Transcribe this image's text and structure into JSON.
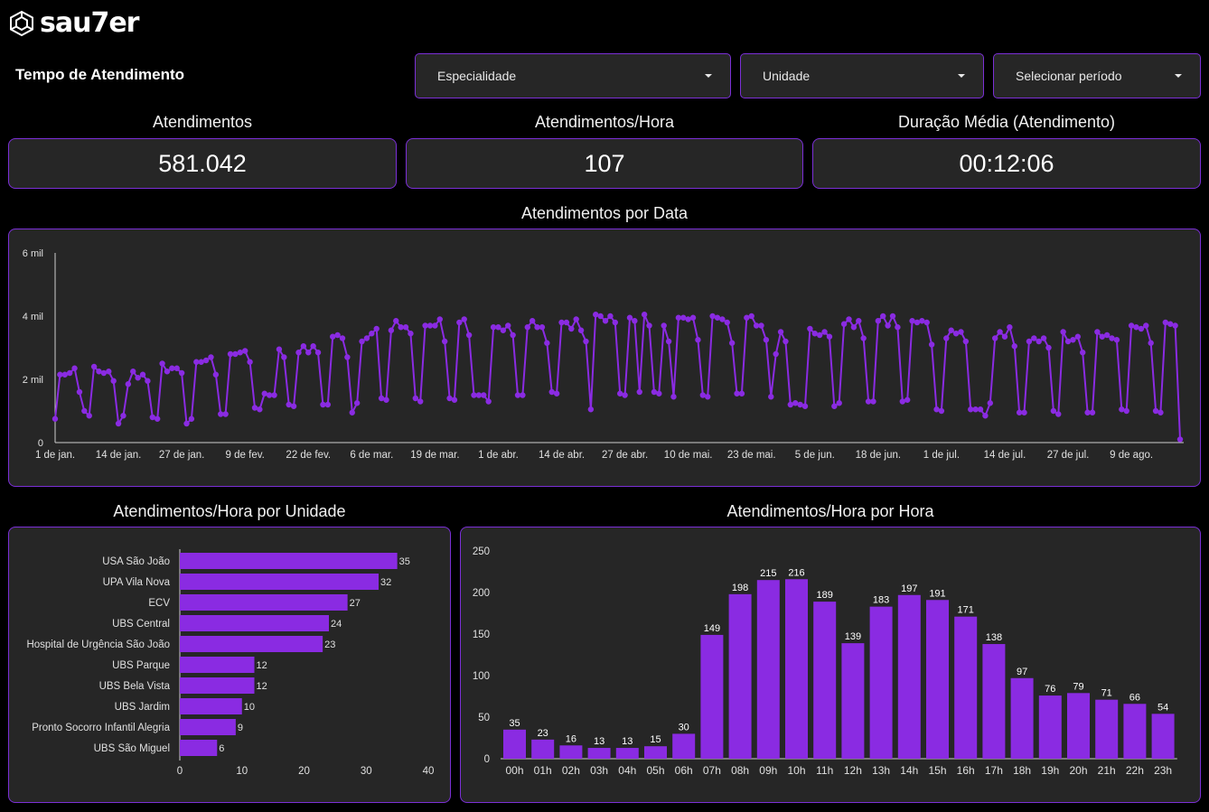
{
  "brand": {
    "name": "sau7er",
    "logo_icon": "hexagon-logo-icon"
  },
  "page": {
    "title": "Tempo de Atendimento"
  },
  "filters": [
    {
      "label": "Especialidade",
      "icon": "chevron-down-icon"
    },
    {
      "label": "Unidade",
      "icon": "chevron-down-icon"
    },
    {
      "label": "Selecionar período",
      "icon": "chevron-down-icon"
    }
  ],
  "kpis": [
    {
      "label": "Atendimentos",
      "value": "581.042"
    },
    {
      "label": "Atendimentos/Hora",
      "value": "107"
    },
    {
      "label": "Duração Média (Atendimento)",
      "value": "00:12:06"
    }
  ],
  "colors": {
    "accent": "#8a2be2",
    "panel_bg": "#262626",
    "border": "#7b2fd6",
    "background": "#000000"
  },
  "chart_data": [
    {
      "type": "line",
      "title": "Atendimentos por Data",
      "ylim": [
        0,
        6000
      ],
      "yticks": [
        0,
        2000,
        4000,
        6000
      ],
      "ytick_labels": [
        "0",
        "2 mil",
        "4 mil",
        "6 mil"
      ],
      "xtick_labels": [
        "1 de jan.",
        "14 de jan.",
        "27 de jan.",
        "9 de fev.",
        "22 de fev.",
        "6 de mar.",
        "19 de mar.",
        "1 de abr.",
        "14 de abr.",
        "27 de abr.",
        "10 de mai.",
        "23 de mai.",
        "5 de jun.",
        "18 de jun.",
        "1 de jul.",
        "14 de jul.",
        "27 de jul.",
        "9 de ago."
      ],
      "xtick_index": [
        0,
        13,
        26,
        39,
        52,
        65,
        78,
        91,
        104,
        117,
        130,
        143,
        156,
        169,
        182,
        195,
        208,
        221
      ],
      "series": [
        {
          "values": [
            750,
            2150,
            2150,
            2200,
            2350,
            1600,
            1000,
            850,
            2400,
            2250,
            2200,
            2250,
            1950,
            600,
            850,
            1850,
            2250,
            2050,
            2150,
            1950,
            800,
            750,
            2500,
            2250,
            2350,
            2350,
            2200,
            600,
            750,
            2550,
            2550,
            2600,
            2700,
            2150,
            900,
            900,
            2800,
            2800,
            2850,
            2900,
            2550,
            1100,
            1050,
            1550,
            1500,
            1500,
            2950,
            2700,
            1200,
            1150,
            2850,
            3050,
            2850,
            3050,
            2850,
            1200,
            1200,
            3350,
            3400,
            3300,
            2700,
            950,
            1250,
            3200,
            3300,
            3450,
            3600,
            1400,
            1350,
            3550,
            3850,
            3650,
            3650,
            3450,
            1400,
            1300,
            3700,
            3700,
            3700,
            3900,
            3200,
            1400,
            1350,
            3800,
            3900,
            3400,
            1500,
            1500,
            1500,
            1300,
            3650,
            3650,
            3550,
            3700,
            3400,
            1500,
            1500,
            3650,
            3850,
            3650,
            3650,
            3150,
            1600,
            1550,
            3800,
            3800,
            3600,
            3900,
            3550,
            3200,
            1050,
            4050,
            4000,
            3850,
            4000,
            3800,
            1550,
            1500,
            3950,
            3850,
            1600,
            4050,
            3700,
            1600,
            1550,
            3700,
            3200,
            1450,
            3950,
            3950,
            3900,
            3950,
            3250,
            1500,
            1450,
            4000,
            3950,
            3900,
            3800,
            3150,
            1550,
            1550,
            3950,
            4000,
            3700,
            3700,
            3250,
            1450,
            2800,
            3500,
            3200,
            1200,
            1250,
            1200,
            1150,
            3600,
            3450,
            3400,
            3500,
            3350,
            1150,
            1250,
            3750,
            3900,
            3650,
            3850,
            3300,
            1300,
            1300,
            3850,
            4000,
            3700,
            4000,
            3650,
            1300,
            1350,
            3850,
            3800,
            3850,
            3800,
            3100,
            1050,
            1000,
            3300,
            3550,
            3450,
            3500,
            3200,
            1050,
            1050,
            1050,
            850,
            1250,
            3300,
            3500,
            3350,
            3650,
            3050,
            950,
            950,
            3200,
            3300,
            3200,
            3300,
            3000,
            1000,
            900,
            3500,
            3200,
            3250,
            3350,
            2850,
            950,
            950,
            3500,
            3350,
            3400,
            3300,
            3250,
            1050,
            1000,
            3700,
            3650,
            3600,
            3700,
            3150,
            1000,
            950,
            3800,
            3750,
            3700,
            100
          ]
        }
      ]
    },
    {
      "type": "bar",
      "title": "Atendimentos/Hora por Unidade",
      "orientation": "horizontal",
      "categories": [
        "USA São João",
        "UPA Vila Nova",
        "ECV",
        "UBS Central",
        "Hospital de Urgência São João",
        "UBS Parque",
        "UBS Bela Vista",
        "UBS Jardim",
        "Pronto Socorro Infantil Alegria",
        "UBS São Miguel"
      ],
      "values": [
        35,
        32,
        27,
        24,
        23,
        12,
        12,
        10,
        9,
        6
      ],
      "xlim": [
        0,
        40
      ],
      "xticks": [
        0,
        10,
        20,
        30,
        40
      ]
    },
    {
      "type": "bar",
      "title": "Atendimentos/Hora por Hora",
      "categories": [
        "00h",
        "01h",
        "02h",
        "03h",
        "04h",
        "05h",
        "06h",
        "07h",
        "08h",
        "09h",
        "10h",
        "11h",
        "12h",
        "13h",
        "14h",
        "15h",
        "16h",
        "17h",
        "18h",
        "19h",
        "20h",
        "21h",
        "22h",
        "23h"
      ],
      "values": [
        35,
        23,
        16,
        13,
        13,
        15,
        30,
        149,
        198,
        215,
        216,
        189,
        139,
        183,
        197,
        191,
        171,
        138,
        97,
        76,
        79,
        71,
        66,
        54
      ],
      "ylim": [
        0,
        250
      ],
      "yticks": [
        0,
        50,
        100,
        150,
        200,
        250
      ]
    }
  ]
}
